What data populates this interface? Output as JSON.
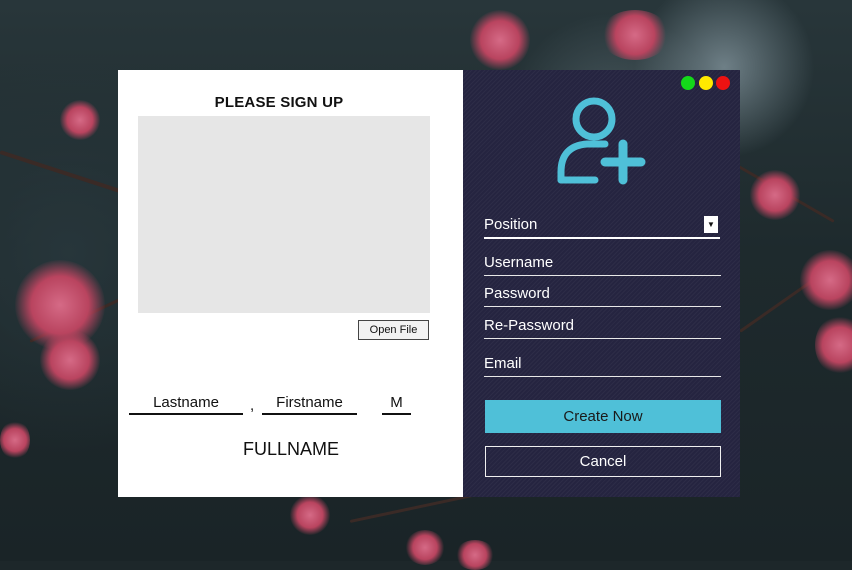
{
  "signup_panel": {
    "title": "PLEASE SIGN UP",
    "open_file_label": "Open File",
    "lastname_label": "Lastname",
    "separator": ",",
    "firstname_label": "Firstname",
    "middle_initial_label": "M",
    "fullname_label": "FULLNAME"
  },
  "form_panel": {
    "window_controls": [
      "green",
      "yellow",
      "red"
    ],
    "user_icon": "add-user-icon",
    "position_label": "Position",
    "username_label": "Username",
    "password_label": "Password",
    "repassword_label": "Re-Password",
    "email_label": "Email",
    "create_label": "Create Now",
    "cancel_label": "Cancel"
  },
  "colors": {
    "left_panel": "#ffffff",
    "right_panel": "#252440",
    "accent": "#4fc0d8",
    "dot_green": "#14d81a",
    "dot_yellow": "#ffe900",
    "dot_red": "#ee1212"
  }
}
